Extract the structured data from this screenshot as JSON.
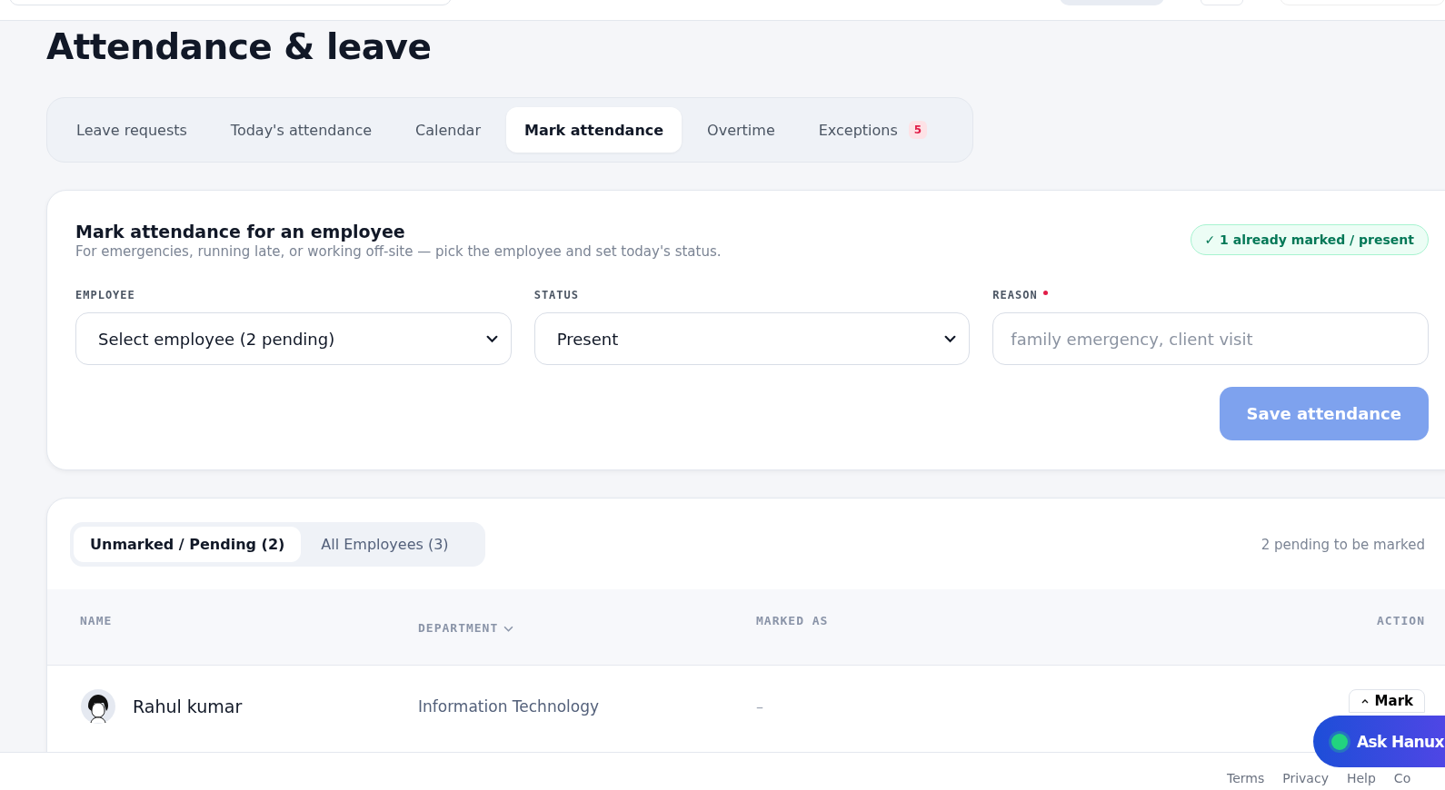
{
  "page_title": "Attendance & leave",
  "tabs": [
    {
      "label": "Leave requests",
      "selected": false
    },
    {
      "label": "Today's attendance",
      "selected": false
    },
    {
      "label": "Calendar",
      "selected": false
    },
    {
      "label": "Mark attendance",
      "selected": true
    },
    {
      "label": "Overtime",
      "selected": false
    },
    {
      "label": "Exceptions",
      "selected": false,
      "badge": "5"
    }
  ],
  "mark_form": {
    "title": "Mark attendance for an employee",
    "subtitle": "For emergencies, running late, or working off-site — pick the employee and set today's status.",
    "status_pill": "✓ 1 already marked / present",
    "fields": [
      {
        "label": "EMPLOYEE",
        "kind": "select",
        "value": "Select employee (2 pending)"
      },
      {
        "label": "STATUS",
        "kind": "select",
        "value": "Present"
      },
      {
        "label": "REASON",
        "kind": "text",
        "placeholder": "family emergency, client visit",
        "required": true
      }
    ],
    "save_button": {
      "label": "Save attendance",
      "disabled": true
    }
  },
  "list": {
    "filters": [
      {
        "label": "Unmarked / Pending (2)",
        "selected": true
      },
      {
        "label": "All Employees (3)",
        "selected": false
      }
    ],
    "summary": "2 pending to be marked",
    "columns": [
      {
        "label": "NAME"
      },
      {
        "label": "DEPARTMENT",
        "sortable": true
      },
      {
        "label": "MARKED AS"
      },
      {
        "label": "ACTION"
      }
    ],
    "rows": [
      {
        "name": "Rahul kumar",
        "department": "Information Technology",
        "marked_as": "–",
        "action": "Mark"
      }
    ]
  },
  "assistant_button": "Ask Hanux",
  "footer_links": [
    "Terms",
    "Privacy",
    "Help",
    "Co"
  ]
}
